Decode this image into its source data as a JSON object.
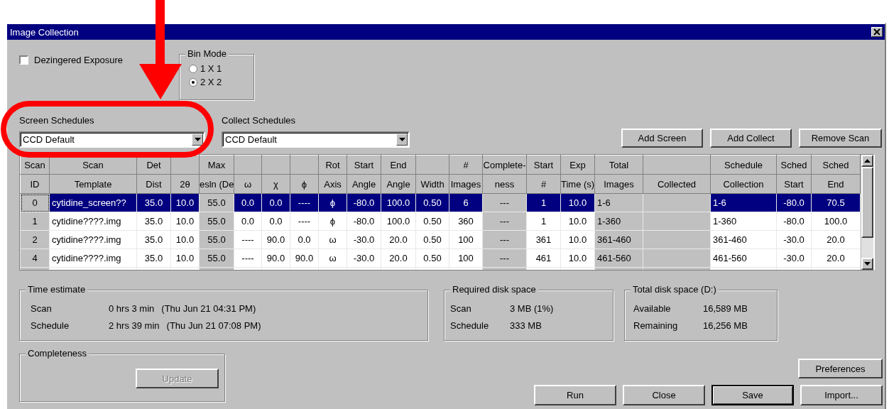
{
  "window": {
    "title": "Image Collection"
  },
  "dezingered_exposure": {
    "label": "Dezingered Exposure",
    "checked": false
  },
  "bin_mode": {
    "title": "Bin Mode",
    "options": [
      {
        "label": "1 X 1",
        "selected": false
      },
      {
        "label": "2 X 2",
        "selected": true
      }
    ]
  },
  "screen_schedules": {
    "label": "Screen Schedules",
    "value": "CCD Default"
  },
  "collect_schedules": {
    "label": "Collect Schedules",
    "value": "CCD Default"
  },
  "scan_buttons": [
    {
      "label": "Add Screen"
    },
    {
      "label": "Add Collect"
    },
    {
      "label": "Remove Scan"
    }
  ],
  "table": {
    "columns": [
      {
        "top": "Scan",
        "label": "ID",
        "kind": "readonly"
      },
      {
        "top": "Scan",
        "label": "Template",
        "kind": "editable"
      },
      {
        "top": "Det",
        "label": "Dist",
        "kind": "editable"
      },
      {
        "label": "2θ",
        "kind": "editable"
      },
      {
        "top": "Max",
        "label": "esln (De",
        "kind": "readonly"
      },
      {
        "label": "ω",
        "kind": "editable"
      },
      {
        "label": "χ",
        "kind": "editable"
      },
      {
        "label": "ϕ",
        "kind": "editable"
      },
      {
        "top": "Rot",
        "label": "Axis",
        "kind": "editable"
      },
      {
        "top": "Start",
        "label": "Angle",
        "kind": "editable"
      },
      {
        "top": "End",
        "label": "Angle",
        "kind": "editable"
      },
      {
        "label": "Width",
        "kind": "editable"
      },
      {
        "top": "#",
        "label": "Images",
        "kind": "editable"
      },
      {
        "top": "Complete-",
        "label": "ness",
        "kind": "readonly"
      },
      {
        "top": "Start",
        "label": "#",
        "kind": "editable"
      },
      {
        "top": "Exp",
        "label": "Time (s)",
        "kind": "editable"
      },
      {
        "top": "Total",
        "label": "Images",
        "kind": "readonly"
      },
      {
        "label": "Collected",
        "kind": "readonly"
      },
      {
        "top": "Schedule",
        "label": "Collection",
        "kind": "editable"
      },
      {
        "top": "Sched",
        "label": "Start",
        "kind": "editable"
      },
      {
        "top": "Sched",
        "label": "End",
        "kind": "editable"
      }
    ],
    "rows": [
      {
        "selected": true,
        "cells": [
          "0",
          "cytidine_screen??",
          "35.0",
          "10.0",
          "55.0",
          "0.0",
          "0.0",
          "----",
          "ϕ",
          "-80.0",
          "100.0",
          "0.50",
          "6",
          "---",
          "1",
          "10.0",
          "1-6",
          null,
          "1-6",
          "-80.0",
          "70.5"
        ]
      },
      {
        "selected": false,
        "cells": [
          "1",
          "cytidine????.img",
          "35.0",
          "10.0",
          "55.0",
          "0.0",
          "0.0",
          "----",
          "ϕ",
          "-80.0",
          "100.0",
          "0.50",
          "360",
          "---",
          "1",
          "10.0",
          "1-360",
          null,
          "1-360",
          "-80.0",
          "100.0"
        ]
      },
      {
        "selected": false,
        "cells": [
          "2",
          "cytidine????.img",
          "35.0",
          "10.0",
          "55.0",
          "----",
          "90.0",
          "0.0",
          "ω",
          "-30.0",
          "20.0",
          "0.50",
          "100",
          "---",
          "361",
          "10.0",
          "361-460",
          null,
          "361-460",
          "-30.0",
          "20.0"
        ]
      },
      {
        "selected": false,
        "cells": [
          "4",
          "cytidine????.img",
          "35.0",
          "10.0",
          "55.0",
          "----",
          "90.0",
          "90.0",
          "ω",
          "-30.0",
          "20.0",
          "0.50",
          "100",
          "---",
          "461",
          "10.0",
          "461-560",
          null,
          "461-560",
          "-30.0",
          "20.0"
        ]
      }
    ]
  },
  "time_estimate": {
    "title": "Time estimate",
    "rows": [
      {
        "label": "Scan",
        "value": "0 hrs 3 min",
        "note": "(Thu Jun 21 04:31 PM)"
      },
      {
        "label": "Schedule",
        "value": "2 hrs 39 min",
        "note": "(Thu Jun 21 07:08 PM)"
      }
    ]
  },
  "required_disk_space": {
    "title": "Required disk space",
    "rows": [
      {
        "label": "Scan",
        "value": "3 MB (1%)"
      },
      {
        "label": "Schedule",
        "value": "333 MB"
      }
    ]
  },
  "total_disk_space": {
    "title": "Total disk space (D:)",
    "rows": [
      {
        "label": "Available",
        "value": "16,589 MB"
      },
      {
        "label": "Remaining",
        "value": "16,256 MB"
      }
    ]
  },
  "completeness": {
    "title": "Completeness",
    "button": {
      "label": "Update",
      "disabled": true
    }
  },
  "preferences_button": {
    "label": "Preferences"
  },
  "action_buttons": [
    {
      "label": "Run",
      "default": false
    },
    {
      "label": "Close",
      "default": false
    },
    {
      "label": "Save",
      "default": true
    },
    {
      "label": "Import...",
      "default": false
    }
  ]
}
